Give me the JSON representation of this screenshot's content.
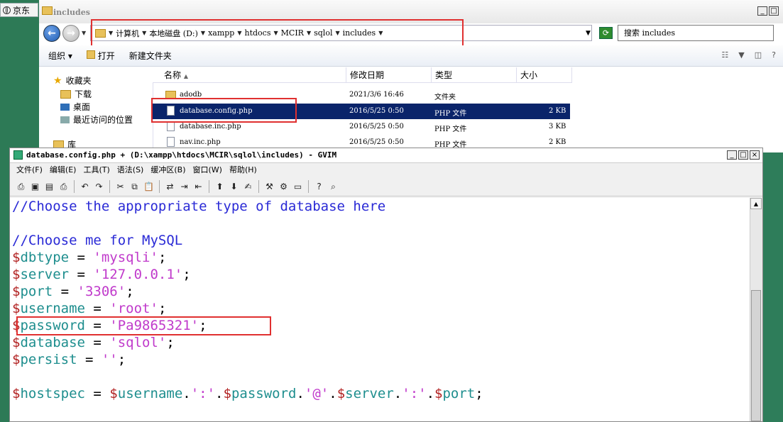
{
  "desktop": {
    "tab_label": "京东"
  },
  "explorer": {
    "title": "includes",
    "breadcrumbs": [
      "计算机",
      "本地磁盘 (D:)",
      "xampp",
      "htdocs",
      "MCIR",
      "sqlol",
      "includes"
    ],
    "search_placeholder": "搜索 includes",
    "toolbar": {
      "organize": "组织",
      "open": "打开",
      "new_folder": "新建文件夹"
    },
    "sidebar": {
      "favorites": "收藏夹",
      "items": [
        "下载",
        "桌面",
        "最近访问的位置"
      ],
      "library": "库"
    },
    "columns": [
      "名称",
      "修改日期",
      "类型",
      "大小"
    ],
    "files": [
      {
        "name": "adodb",
        "date": "2021/3/6 16:46",
        "type": "文件夹",
        "size": ""
      },
      {
        "name": "database.config.php",
        "date": "2016/5/25 0:50",
        "type": "PHP 文件",
        "size": "2 KB"
      },
      {
        "name": "database.inc.php",
        "date": "2016/5/25 0:50",
        "type": "PHP 文件",
        "size": "3 KB"
      },
      {
        "name": "nav.inc.php",
        "date": "2016/5/25 0:50",
        "type": "PHP 文件",
        "size": "2 KB"
      }
    ]
  },
  "gvim": {
    "title": "database.config.php + (D:\\xampp\\htdocs\\MCIR\\sqlol\\includes) - GVIM",
    "menu": [
      "文件(F)",
      "编辑(E)",
      "工具(T)",
      "语法(S)",
      "缓冲区(B)",
      "窗口(W)",
      "帮助(H)"
    ],
    "code": {
      "comment1": "//Choose the appropriate type of database here",
      "comment2": "//Choose me for MySQL",
      "assignments": [
        {
          "var": "dbtype",
          "value": "'mysqli'"
        },
        {
          "var": "server",
          "value": "'127.0.0.1'"
        },
        {
          "var": "port",
          "value": "'3306'"
        },
        {
          "var": "username",
          "value": "'root'"
        },
        {
          "var": "password",
          "value": "'Pa9865321'"
        },
        {
          "var": "database",
          "value": "'sqlol'"
        },
        {
          "var": "persist",
          "value": "''"
        }
      ],
      "hostspec_var": "hostspec"
    }
  },
  "colors": {
    "highlight_box": "#e03030",
    "selection": "#0a246a",
    "comment": "#2a2ad6",
    "string": "#c03acb",
    "variable": "#1e8e8e",
    "dollar": "#b22222"
  }
}
